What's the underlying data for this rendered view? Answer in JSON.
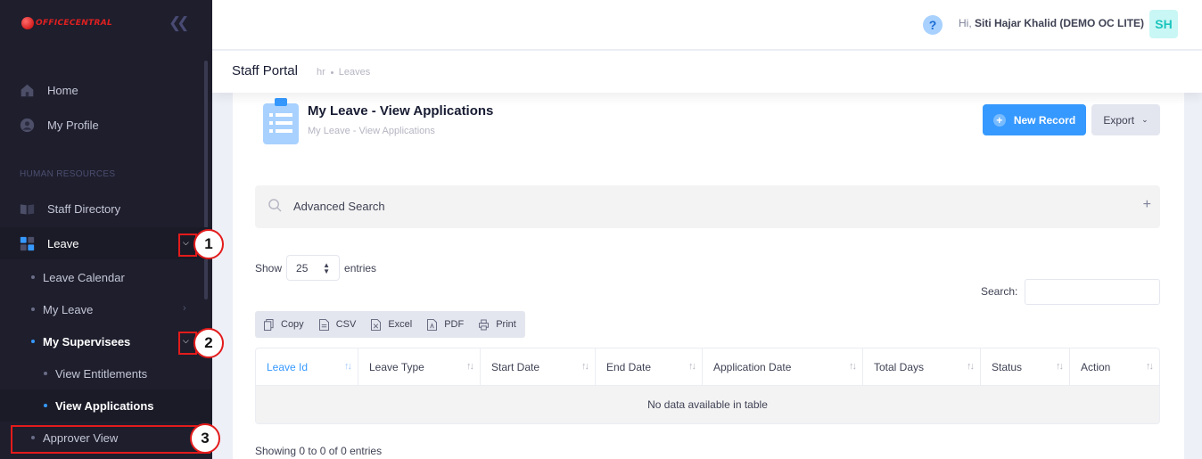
{
  "brand": {
    "logo_text": "OFFICECENTRAL"
  },
  "sidebar": {
    "home": "Home",
    "my_profile": "My Profile",
    "section_hr": "HUMAN RESOURCES",
    "staff_directory": "Staff Directory",
    "leave": "Leave",
    "leave_calendar": "Leave Calendar",
    "my_leave": "My Leave",
    "my_supervisees": "My Supervisees",
    "view_entitlements": "View Entitlements",
    "view_applications": "View Applications",
    "approver_view": "Approver View"
  },
  "annotations": {
    "one": "1",
    "two": "2",
    "three": "3"
  },
  "header": {
    "help": "?",
    "greeting_prefix": "Hi,",
    "user_name": "Siti Hajar Khalid (DEMO OC LITE)",
    "avatar_initials": "SH"
  },
  "subheader": {
    "title": "Staff Portal",
    "breadcrumbs": [
      "hr",
      "Leaves"
    ]
  },
  "page": {
    "title": "My Leave - View Applications",
    "subtitle": "My Leave - View Applications",
    "new_record": "New Record",
    "export": "Export",
    "advanced_search": "Advanced Search",
    "show_label": "Show",
    "entries_value": "25",
    "entries_label": "entries",
    "search_label": "Search:",
    "buttons": {
      "copy": "Copy",
      "csv": "CSV",
      "excel": "Excel",
      "pdf": "PDF",
      "print": "Print"
    },
    "columns": [
      "Leave Id",
      "Leave Type",
      "Start Date",
      "End Date",
      "Application Date",
      "Total Days",
      "Status",
      "Action"
    ],
    "empty_message": "No data available in table",
    "info": "Showing 0 to 0 of 0 entries"
  },
  "colors": {
    "accent": "#3699ff",
    "sidebar_bg": "#1e1e2d",
    "annotation_red": "#e31b1b"
  }
}
